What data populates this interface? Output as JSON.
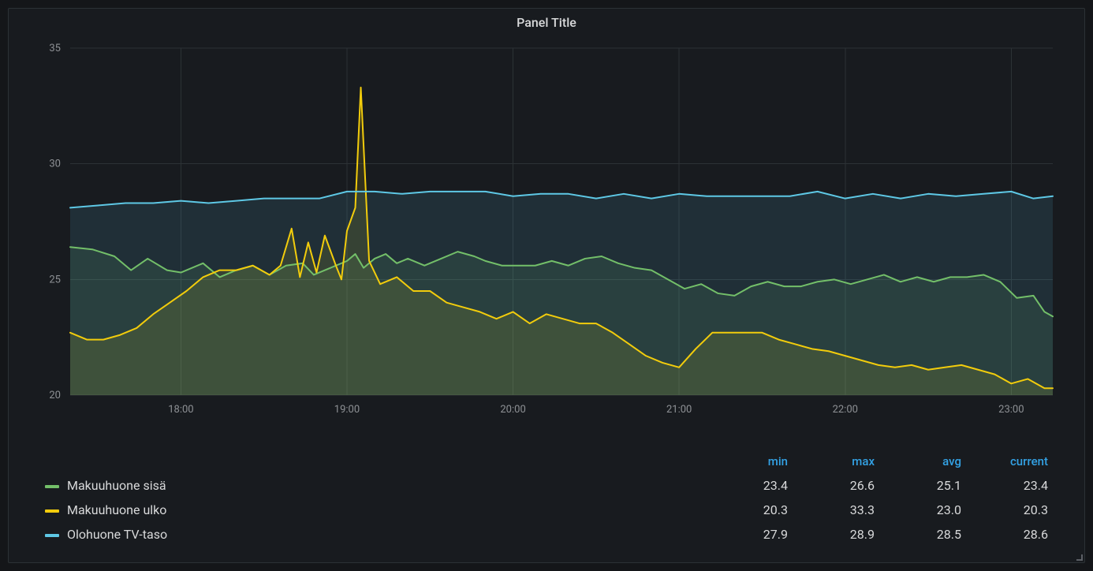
{
  "panel": {
    "title": "Panel Title"
  },
  "legend": {
    "headers": {
      "min": "min",
      "max": "max",
      "avg": "avg",
      "current": "current"
    }
  },
  "chart_data": {
    "type": "line",
    "xlabel": "",
    "ylabel": "",
    "ylim": [
      20,
      35
    ],
    "y_ticks": [
      20,
      25,
      30,
      35
    ],
    "x_ticks": [
      "18:00",
      "19:00",
      "20:00",
      "21:00",
      "22:00",
      "23:00"
    ],
    "x_range_minutes": [
      1040,
      1395
    ],
    "series": [
      {
        "name": "Makuuhuone sisä",
        "color": "#73bf69",
        "fill": true,
        "stats": {
          "min": "23.4",
          "max": "26.6",
          "avg": "25.1",
          "current": "23.4"
        },
        "points": [
          [
            1040,
            26.4
          ],
          [
            1048,
            26.3
          ],
          [
            1056,
            26.0
          ],
          [
            1062,
            25.4
          ],
          [
            1068,
            25.9
          ],
          [
            1075,
            25.4
          ],
          [
            1080,
            25.3
          ],
          [
            1088,
            25.7
          ],
          [
            1094,
            25.1
          ],
          [
            1100,
            25.4
          ],
          [
            1106,
            25.6
          ],
          [
            1112,
            25.2
          ],
          [
            1118,
            25.6
          ],
          [
            1124,
            25.7
          ],
          [
            1128,
            25.2
          ],
          [
            1134,
            25.5
          ],
          [
            1140,
            25.8
          ],
          [
            1143,
            26.1
          ],
          [
            1146,
            25.5
          ],
          [
            1150,
            25.9
          ],
          [
            1154,
            26.1
          ],
          [
            1158,
            25.7
          ],
          [
            1162,
            25.9
          ],
          [
            1168,
            25.6
          ],
          [
            1174,
            25.9
          ],
          [
            1180,
            26.2
          ],
          [
            1186,
            26.0
          ],
          [
            1190,
            25.8
          ],
          [
            1196,
            25.6
          ],
          [
            1202,
            25.6
          ],
          [
            1208,
            25.6
          ],
          [
            1214,
            25.8
          ],
          [
            1220,
            25.6
          ],
          [
            1226,
            25.9
          ],
          [
            1232,
            26.0
          ],
          [
            1238,
            25.7
          ],
          [
            1244,
            25.5
          ],
          [
            1250,
            25.4
          ],
          [
            1256,
            25.0
          ],
          [
            1262,
            24.6
          ],
          [
            1268,
            24.8
          ],
          [
            1274,
            24.4
          ],
          [
            1280,
            24.3
          ],
          [
            1286,
            24.7
          ],
          [
            1292,
            24.9
          ],
          [
            1298,
            24.7
          ],
          [
            1304,
            24.7
          ],
          [
            1310,
            24.9
          ],
          [
            1316,
            25.0
          ],
          [
            1322,
            24.8
          ],
          [
            1328,
            25.0
          ],
          [
            1334,
            25.2
          ],
          [
            1340,
            24.9
          ],
          [
            1346,
            25.1
          ],
          [
            1352,
            24.9
          ],
          [
            1358,
            25.1
          ],
          [
            1364,
            25.1
          ],
          [
            1370,
            25.2
          ],
          [
            1376,
            24.9
          ],
          [
            1382,
            24.2
          ],
          [
            1388,
            24.3
          ],
          [
            1392,
            23.6
          ],
          [
            1395,
            23.4
          ]
        ]
      },
      {
        "name": "Makuuhuone ulko",
        "color": "#f2cc0c",
        "fill": true,
        "stats": {
          "min": "20.3",
          "max": "33.3",
          "avg": "23.0",
          "current": "20.3"
        },
        "points": [
          [
            1040,
            22.7
          ],
          [
            1046,
            22.4
          ],
          [
            1052,
            22.4
          ],
          [
            1058,
            22.6
          ],
          [
            1064,
            22.9
          ],
          [
            1070,
            23.5
          ],
          [
            1076,
            24.0
          ],
          [
            1082,
            24.5
          ],
          [
            1088,
            25.1
          ],
          [
            1094,
            25.4
          ],
          [
            1100,
            25.4
          ],
          [
            1106,
            25.6
          ],
          [
            1112,
            25.2
          ],
          [
            1116,
            25.6
          ],
          [
            1120,
            27.2
          ],
          [
            1123,
            25.1
          ],
          [
            1126,
            26.6
          ],
          [
            1129,
            25.3
          ],
          [
            1132,
            26.9
          ],
          [
            1136,
            25.6
          ],
          [
            1138,
            25.0
          ],
          [
            1140,
            27.1
          ],
          [
            1143,
            28.1
          ],
          [
            1145,
            33.3
          ],
          [
            1148,
            25.8
          ],
          [
            1152,
            24.8
          ],
          [
            1158,
            25.1
          ],
          [
            1164,
            24.5
          ],
          [
            1170,
            24.5
          ],
          [
            1176,
            24.0
          ],
          [
            1182,
            23.8
          ],
          [
            1188,
            23.6
          ],
          [
            1194,
            23.3
          ],
          [
            1200,
            23.6
          ],
          [
            1206,
            23.1
          ],
          [
            1212,
            23.5
          ],
          [
            1218,
            23.3
          ],
          [
            1224,
            23.1
          ],
          [
            1230,
            23.1
          ],
          [
            1236,
            22.7
          ],
          [
            1242,
            22.2
          ],
          [
            1248,
            21.7
          ],
          [
            1254,
            21.4
          ],
          [
            1260,
            21.2
          ],
          [
            1266,
            22.0
          ],
          [
            1272,
            22.7
          ],
          [
            1278,
            22.7
          ],
          [
            1284,
            22.7
          ],
          [
            1290,
            22.7
          ],
          [
            1296,
            22.4
          ],
          [
            1302,
            22.2
          ],
          [
            1308,
            22.0
          ],
          [
            1314,
            21.9
          ],
          [
            1320,
            21.7
          ],
          [
            1326,
            21.5
          ],
          [
            1332,
            21.3
          ],
          [
            1338,
            21.2
          ],
          [
            1344,
            21.3
          ],
          [
            1350,
            21.1
          ],
          [
            1356,
            21.2
          ],
          [
            1362,
            21.3
          ],
          [
            1368,
            21.1
          ],
          [
            1374,
            20.9
          ],
          [
            1380,
            20.5
          ],
          [
            1386,
            20.7
          ],
          [
            1392,
            20.3
          ],
          [
            1395,
            20.3
          ]
        ]
      },
      {
        "name": "Olohuone TV-taso",
        "color": "#5ec8e5",
        "fill": true,
        "stats": {
          "min": "27.9",
          "max": "28.9",
          "avg": "28.5",
          "current": "28.6"
        },
        "points": [
          [
            1040,
            28.1
          ],
          [
            1050,
            28.2
          ],
          [
            1060,
            28.3
          ],
          [
            1070,
            28.3
          ],
          [
            1080,
            28.4
          ],
          [
            1090,
            28.3
          ],
          [
            1100,
            28.4
          ],
          [
            1110,
            28.5
          ],
          [
            1120,
            28.5
          ],
          [
            1130,
            28.5
          ],
          [
            1140,
            28.8
          ],
          [
            1150,
            28.8
          ],
          [
            1160,
            28.7
          ],
          [
            1170,
            28.8
          ],
          [
            1180,
            28.8
          ],
          [
            1190,
            28.8
          ],
          [
            1200,
            28.6
          ],
          [
            1210,
            28.7
          ],
          [
            1220,
            28.7
          ],
          [
            1230,
            28.5
          ],
          [
            1240,
            28.7
          ],
          [
            1250,
            28.5
          ],
          [
            1260,
            28.7
          ],
          [
            1270,
            28.6
          ],
          [
            1280,
            28.6
          ],
          [
            1290,
            28.6
          ],
          [
            1300,
            28.6
          ],
          [
            1310,
            28.8
          ],
          [
            1320,
            28.5
          ],
          [
            1330,
            28.7
          ],
          [
            1340,
            28.5
          ],
          [
            1350,
            28.7
          ],
          [
            1360,
            28.6
          ],
          [
            1370,
            28.7
          ],
          [
            1380,
            28.8
          ],
          [
            1388,
            28.5
          ],
          [
            1395,
            28.6
          ]
        ]
      }
    ]
  }
}
